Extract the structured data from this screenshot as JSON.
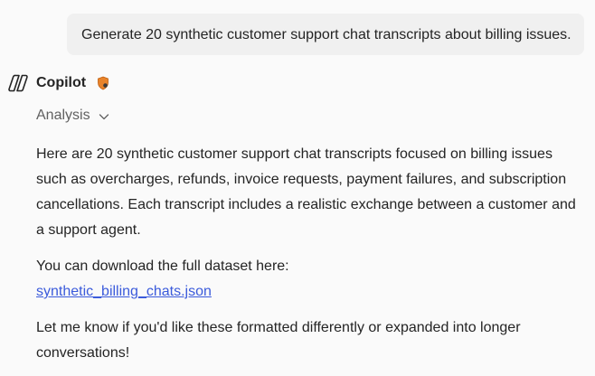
{
  "user_message": "Generate 20 synthetic customer support chat transcripts about billing issues.",
  "assistant": {
    "name": "Copilot",
    "analysis_label": "Analysis",
    "paragraph1": "Here are 20 synthetic customer support chat transcripts focused on billing issues such as overcharges, refunds, invoice requests, payment failures, and subscription cancellations. Each transcript includes a realistic exchange between a customer and a support agent.",
    "download_text": "You can download the full dataset here:",
    "download_link": "synthetic_billing_chats.json",
    "closing": "Let me know if you'd like these formatted differently or expanded into longer conversations!"
  },
  "colors": {
    "link": "#3b5bdb",
    "shield": "#e8832a",
    "muted": "#616161"
  },
  "icons": {
    "logo": "copilot-logo-icon",
    "shield": "shield-icon",
    "chevron": "chevron-down-icon"
  }
}
